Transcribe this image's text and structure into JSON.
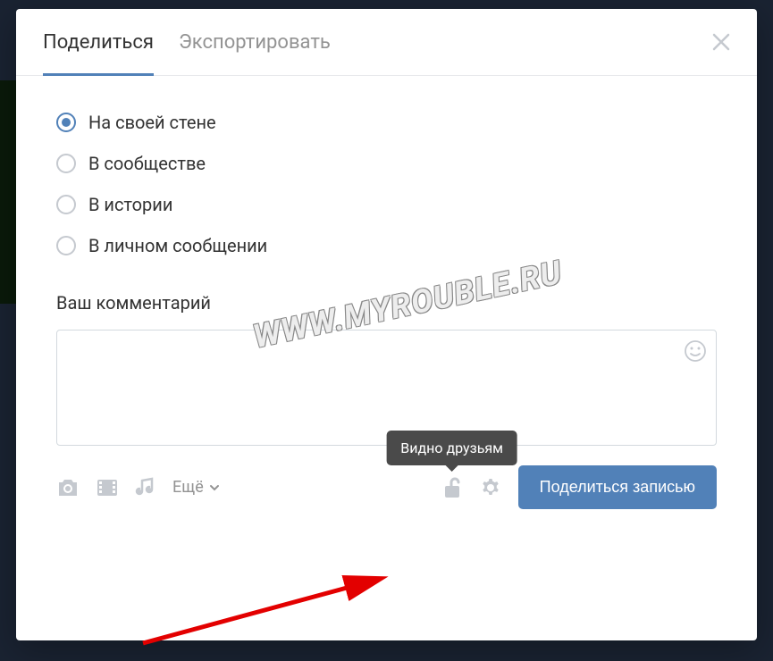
{
  "tabs": {
    "share": "Поделиться",
    "export": "Экспортировать"
  },
  "radio_options": {
    "own_wall": "На своей стене",
    "community": "В сообществе",
    "story": "В истории",
    "private_message": "В личном сообщении"
  },
  "comment": {
    "label": "Ваш комментарий",
    "value": ""
  },
  "footer": {
    "more": "Ещё",
    "tooltip_lock": "Видно друзьям",
    "share_button": "Поделиться записью"
  },
  "watermark": "WWW.MYROUBLE.RU"
}
